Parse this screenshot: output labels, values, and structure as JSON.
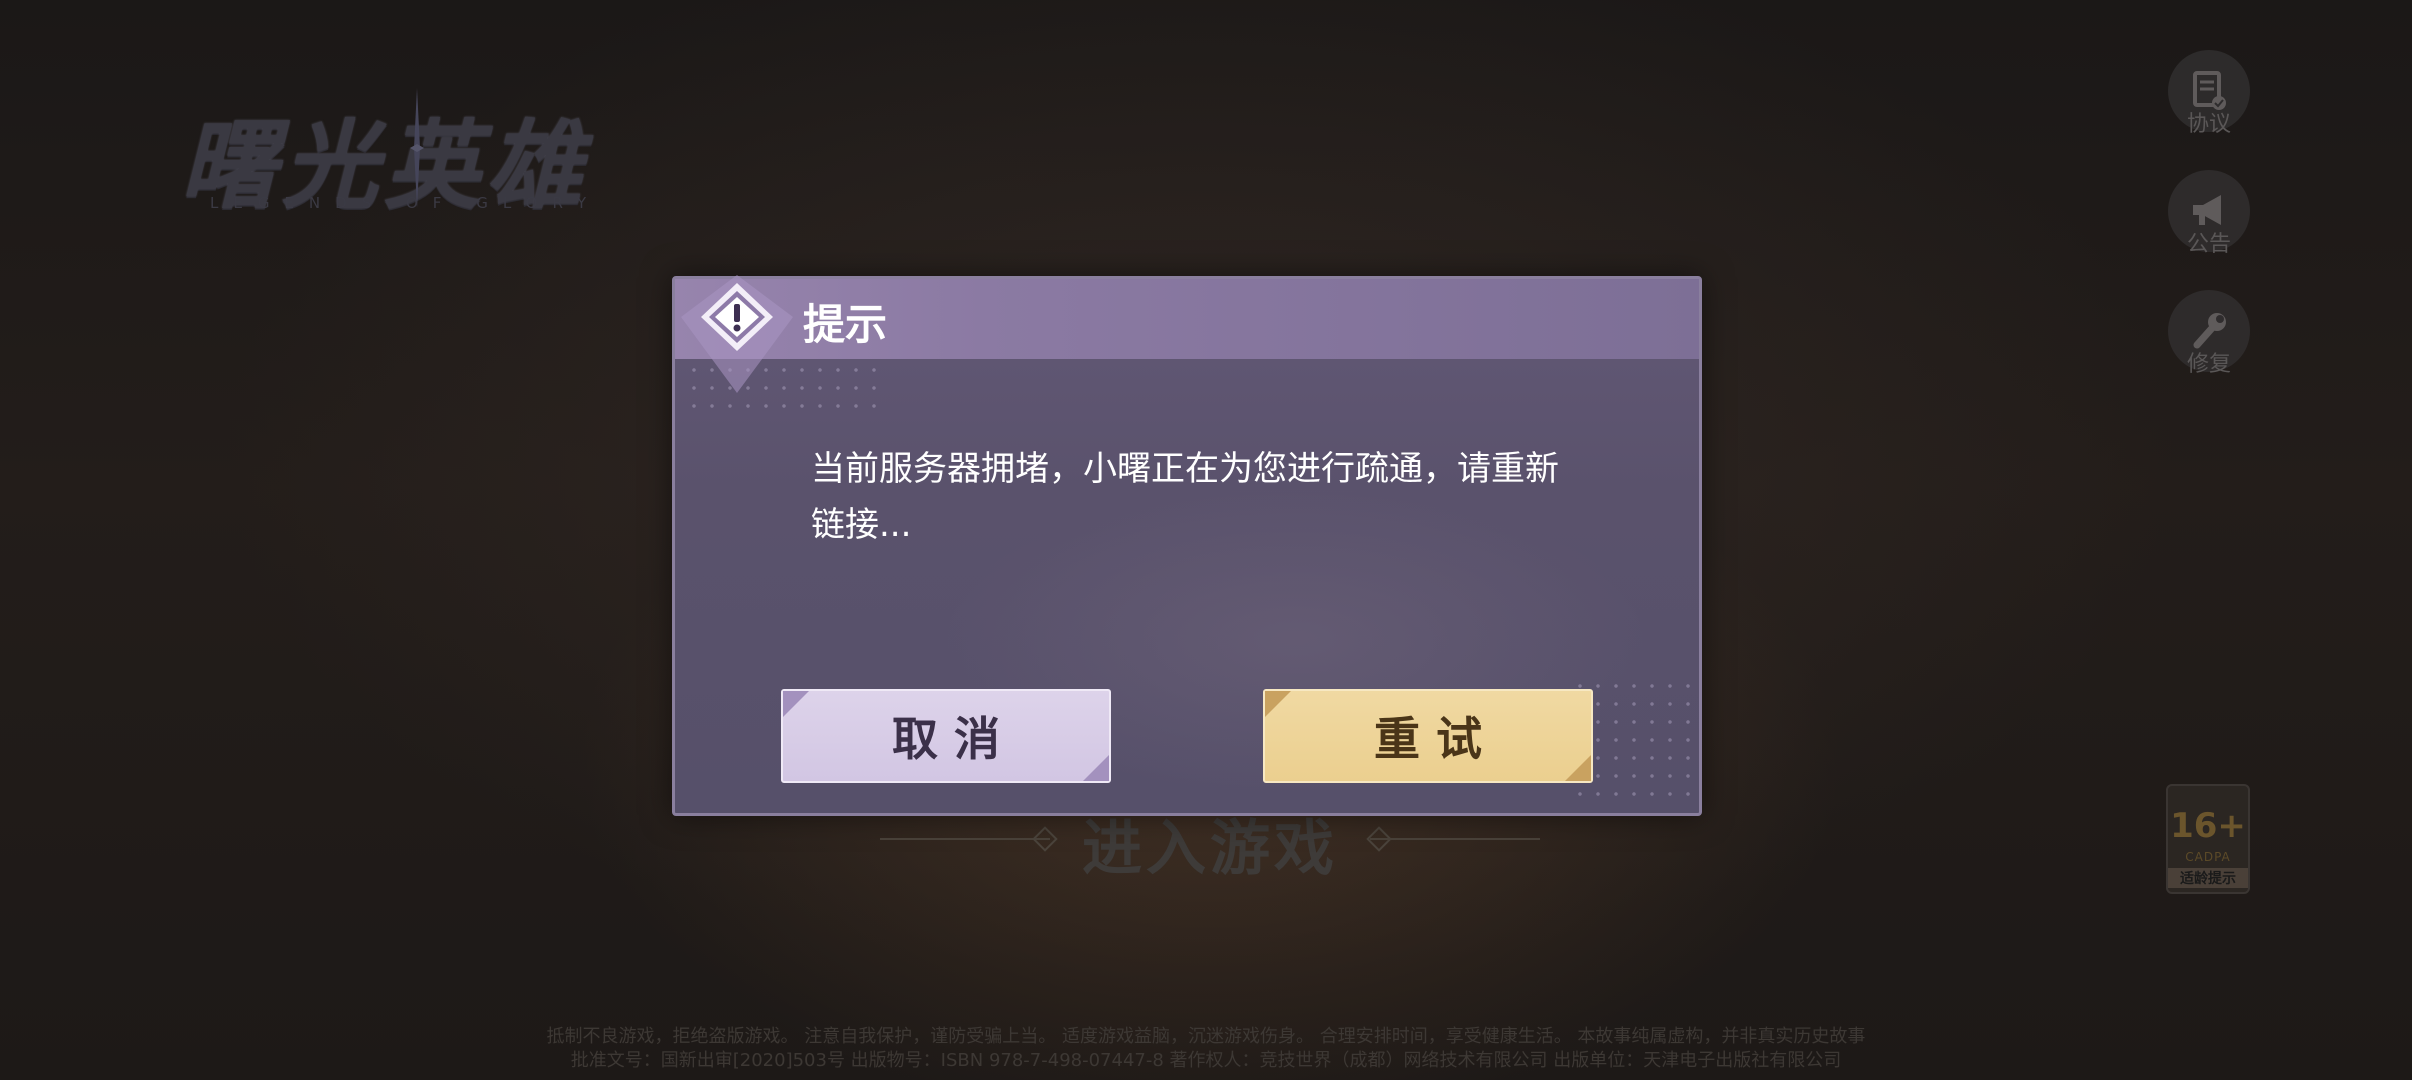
{
  "background": {
    "logo": {
      "title": "曙光英雄",
      "subtitle": "LEGENDS OF GLORY"
    },
    "side_buttons": [
      {
        "label": "协议",
        "icon": "agreement-icon"
      },
      {
        "label": "公告",
        "icon": "megaphone-icon"
      },
      {
        "label": "修复",
        "icon": "wrench-icon"
      }
    ],
    "enter_game_label": "进入游戏",
    "age_rating": {
      "rating": "16+",
      "org": "CADPA",
      "label": "适龄提示"
    },
    "footer": {
      "line1": "抵制不良游戏，拒绝盗版游戏。 注意自我保护，谨防受骗上当。 适度游戏益脑，沉迷游戏伤身。 合理安排时间，享受健康生活。 本故事纯属虚构，并非真实历史故事",
      "line2": "批准文号：国新出审[2020]503号 出版物号：ISBN 978-7-498-07447-8 著作权人：竞技世界（成都）网络技术有限公司 出版单位：天津电子出版社有限公司"
    }
  },
  "dialog": {
    "icon": "exclamation-diamond-icon",
    "title": "提示",
    "message_line1": "当前服务器拥堵，小曙正在为您进行疏通，请重新",
    "message_line2": "链接...",
    "cancel_label": "取消",
    "retry_label": "重试"
  },
  "colors": {
    "dialog_header": "#8b7aa3",
    "dialog_body": "#5a526c",
    "cancel_button": "#d8cde8",
    "retry_button": "#eed494"
  }
}
